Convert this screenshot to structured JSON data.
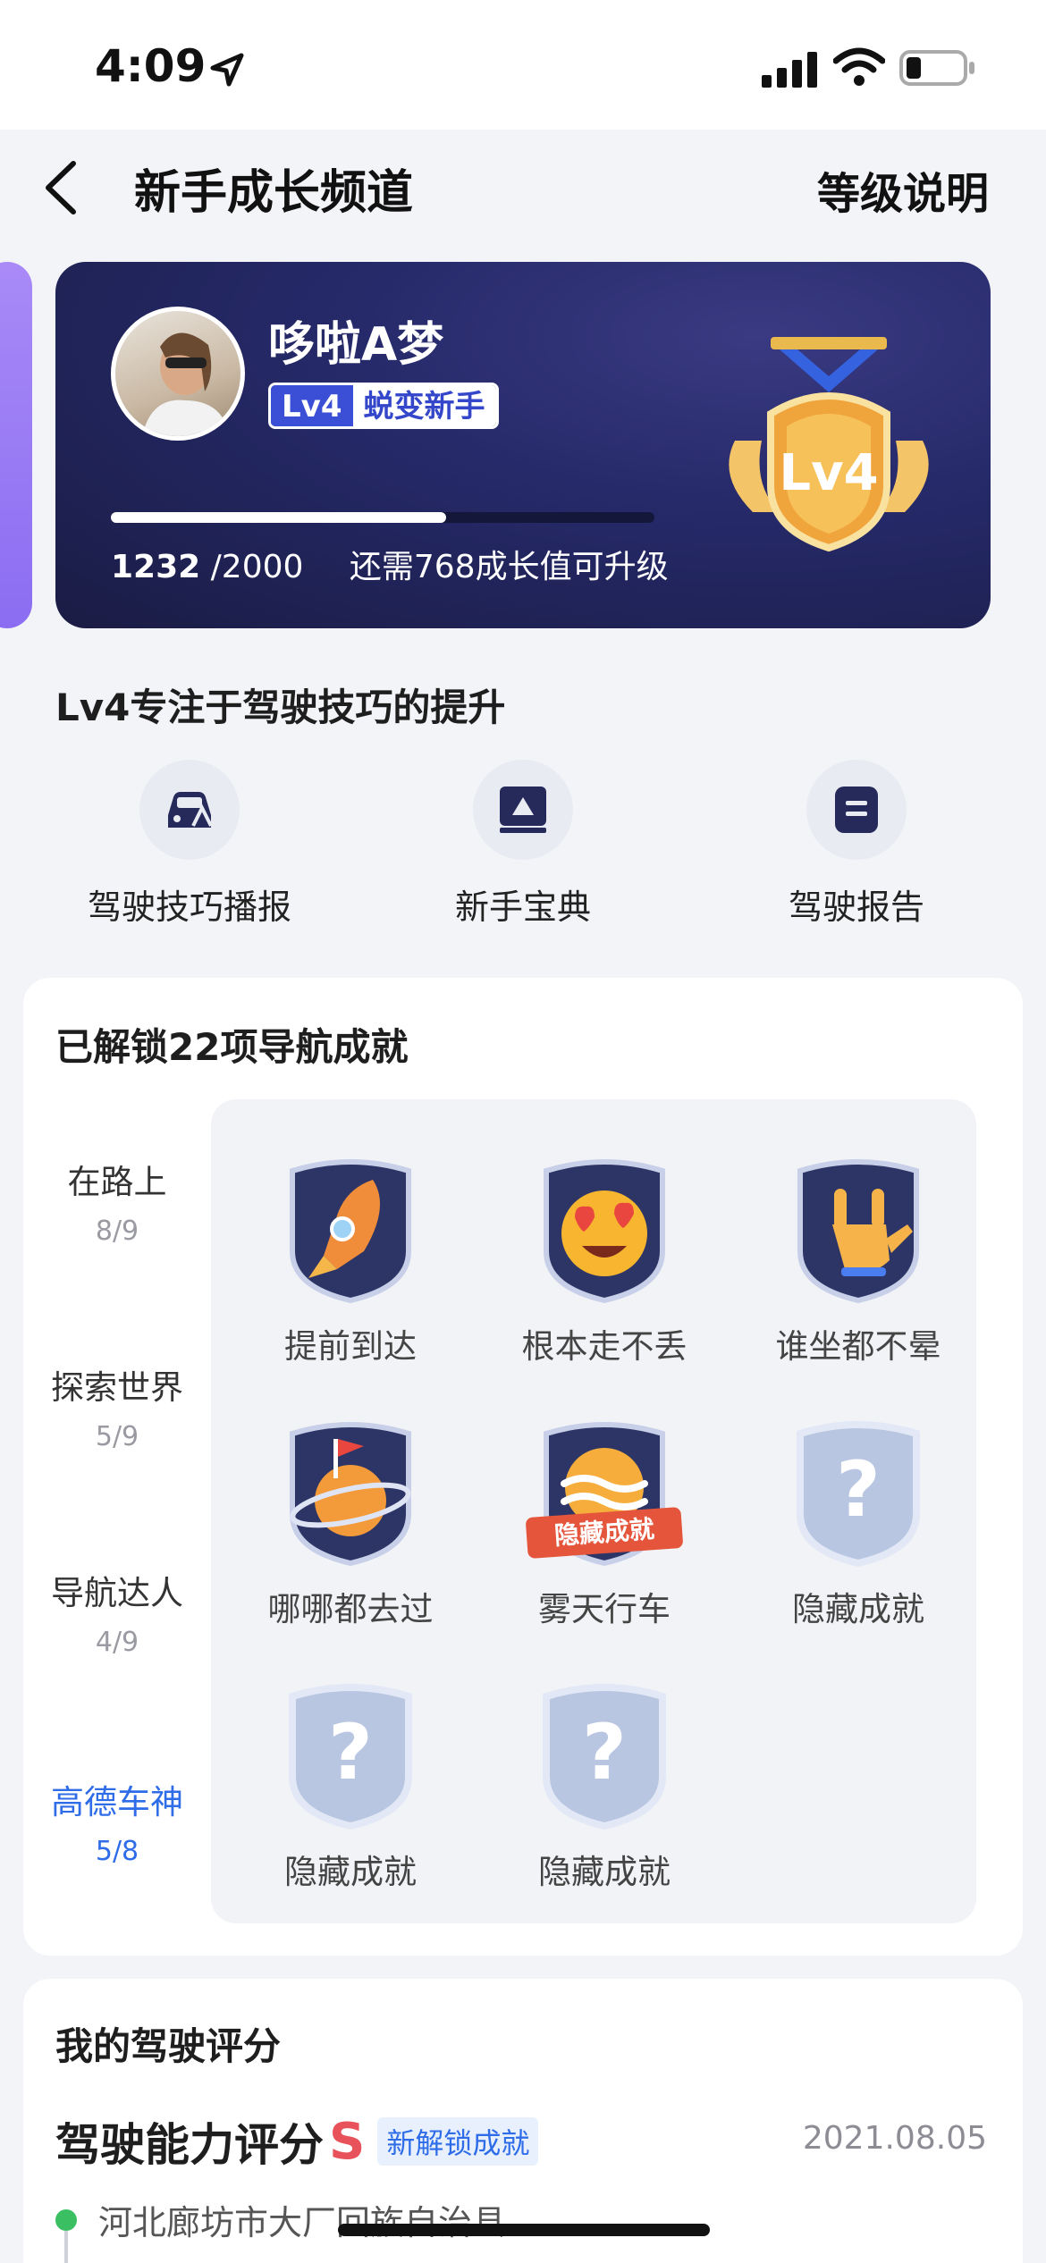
{
  "status_bar": {
    "time": "4:09"
  },
  "nav": {
    "title": "新手成长频道",
    "right_link": "等级说明"
  },
  "level_card": {
    "user_name": "哆啦A梦",
    "level": "Lv4",
    "level_title": "蜕变新手",
    "progress_current": "1232",
    "progress_total": "/2000",
    "progress_fraction": 0.616,
    "progress_hint": "还需768成长值可升级",
    "medal_text": "Lv4"
  },
  "level_desc": "Lv4专注于驾驶技巧的提升",
  "shortcuts": [
    {
      "label": "驾驶技巧播报",
      "icon": "car-icon"
    },
    {
      "label": "新手宝典",
      "icon": "book-icon"
    },
    {
      "label": "驾驶报告",
      "icon": "report-icon"
    }
  ],
  "achievements": {
    "title": "已解锁22项导航成就",
    "categories": [
      {
        "name": "在路上",
        "count": "8/9"
      },
      {
        "name": "探索世界",
        "count": "5/9"
      },
      {
        "name": "导航达人",
        "count": "4/9"
      },
      {
        "name": "高德车神",
        "count": "5/8"
      }
    ],
    "badges": [
      {
        "name": "提前到达",
        "icon": "rocket-icon"
      },
      {
        "name": "根本走不丢",
        "icon": "heart-eyes-icon"
      },
      {
        "name": "谁坐都不晕",
        "icon": "hand-icon"
      },
      {
        "name": "哪哪都去过",
        "icon": "planet-flag-icon"
      },
      {
        "name": "雾天行车",
        "icon": "fog-sun-icon",
        "ribbon": "隐藏成就"
      },
      {
        "name": "隐藏成就",
        "icon": "question-icon"
      },
      {
        "name": "隐藏成就",
        "icon": "question-icon"
      },
      {
        "name": "隐藏成就",
        "icon": "question-icon"
      }
    ]
  },
  "rating": {
    "title": "我的驾驶评分",
    "label": "驾驶能力评分",
    "grade": "S",
    "new_tag": "新解锁成就",
    "date": "2021.08.05",
    "location": "河北廊坊市大厂回族自治县"
  },
  "colors": {
    "accent": "#2f6de8",
    "card_bg": "#262a6a",
    "grade": "#e8525a"
  }
}
